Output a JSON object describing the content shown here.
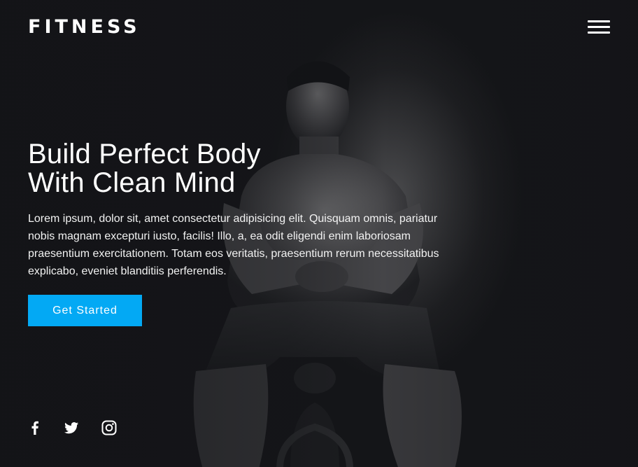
{
  "navbar": {
    "logo": "FITNESS",
    "menu_icon": "hamburger-menu-icon"
  },
  "hero": {
    "headline_line1": "Build Perfect Body",
    "headline_line2": "With Clean Mind",
    "description": "Lorem ipsum, dolor sit, amet consectetur adipisicing elit. Quisquam omnis, pariatur nobis magnam excepturi iusto, facilis! Illo, a, ea odit eligendi enim laboriosam praesentium exercitationem. Totam eos veritatis, praesentium rerum necessitatibus explicabo, eveniet blanditiis perferendis.",
    "cta_label": "Get Started"
  },
  "social": {
    "icons": [
      "facebook-icon",
      "twitter-icon",
      "instagram-icon"
    ]
  },
  "colors": {
    "background": "#131417",
    "accent": "#03a9f4",
    "text": "#ffffff"
  }
}
